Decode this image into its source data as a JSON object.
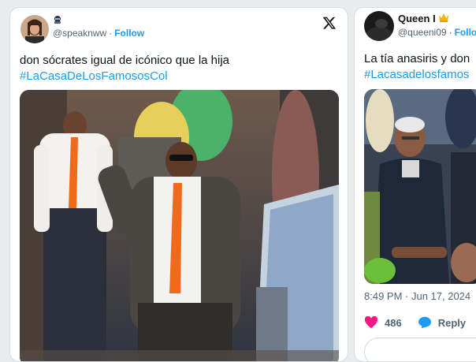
{
  "left_tweet": {
    "handle": "@speaknww",
    "follow_label": "Follow",
    "separator": "·",
    "text_line": "don sócrates igual de icónico que la hija",
    "hashtag": "#LaCasaDeLosFamososCol",
    "icon": "x-logo-icon"
  },
  "right_tweet": {
    "display_name": "Queen I",
    "handle": "@queeni09",
    "follow_label": "Follo",
    "separator": "·",
    "text_line": "La tía anasiris y don",
    "hashtag": "#Lacasadelosfamos",
    "timestamp": "8:49 PM · Jun 17, 2024",
    "like_count": "486",
    "reply_label": "Reply"
  },
  "colors": {
    "link": "#1d9bf0",
    "text": "#0f1419",
    "muted": "#536471",
    "like": "#f91880"
  }
}
